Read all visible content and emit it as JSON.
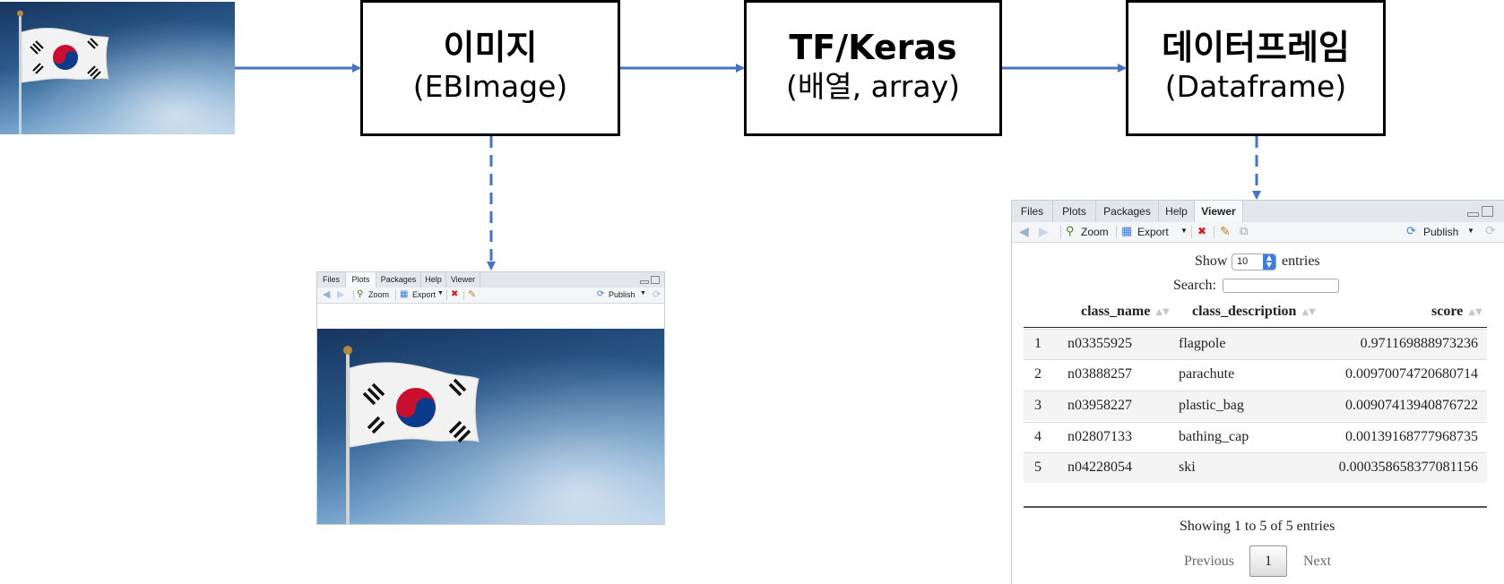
{
  "diagram": {
    "nodes": [
      {
        "title": "이미지",
        "subtitle": "(EBImage)"
      },
      {
        "title": "TF/Keras",
        "subtitle": "(배열, array)"
      },
      {
        "title": "데이터프레임",
        "subtitle": "(Dataframe)"
      }
    ]
  },
  "colors": {
    "arrow": "#4472C4",
    "tab_active": "#f7f8f9",
    "accent_blue": "#3b7ddd"
  },
  "left_pane": {
    "tabs": [
      "Files",
      "Plots",
      "Packages",
      "Help",
      "Viewer"
    ],
    "toolbar": {
      "zoom": "Zoom",
      "export": "Export",
      "publish": "Publish"
    }
  },
  "right_pane": {
    "tabs": [
      "Files",
      "Plots",
      "Packages",
      "Help",
      "Viewer"
    ],
    "active_tab": "Viewer",
    "toolbar": {
      "zoom": "Zoom",
      "export": "Export",
      "publish": "Publish"
    }
  },
  "datatable": {
    "show_label": "Show",
    "page_length": "10",
    "entries_label": "entries",
    "search_label": "Search:",
    "search_value": "",
    "columns": [
      "class_name",
      "class_description",
      "score"
    ],
    "rows": [
      {
        "idx": "1",
        "class_name": "n03355925",
        "class_description": "flagpole",
        "score": "0.971169888973236"
      },
      {
        "idx": "2",
        "class_name": "n03888257",
        "class_description": "parachute",
        "score": "0.00970074720680714"
      },
      {
        "idx": "3",
        "class_name": "n03958227",
        "class_description": "plastic_bag",
        "score": "0.00907413940876722"
      },
      {
        "idx": "4",
        "class_name": "n02807133",
        "class_description": "bathing_cap",
        "score": "0.00139168777968735"
      },
      {
        "idx": "5",
        "class_name": "n04228054",
        "class_description": "ski",
        "score": "0.000358658377081156"
      }
    ],
    "info": "Showing 1 to 5 of 5 entries",
    "previous": "Previous",
    "current_page": "1",
    "next": "Next"
  }
}
